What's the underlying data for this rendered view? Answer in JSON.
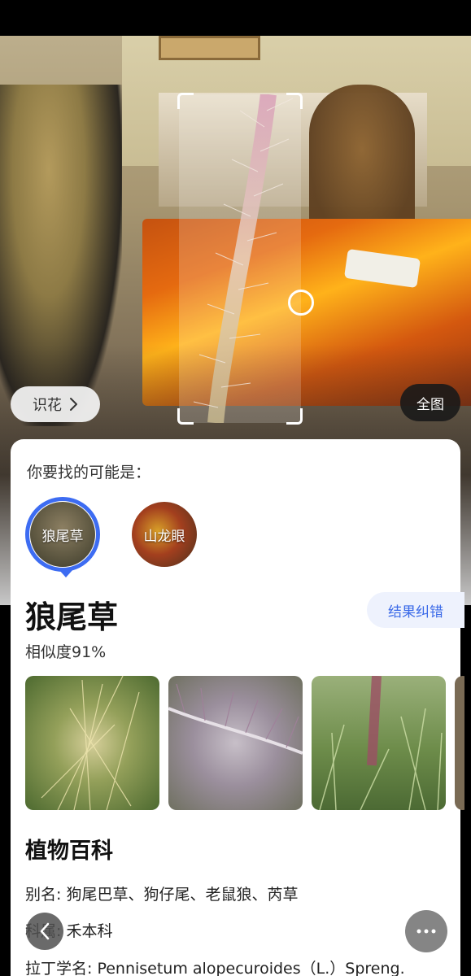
{
  "camera": {
    "recognize_button_label": "识花",
    "full_view_button_label": "全图"
  },
  "result": {
    "prompt": "你要找的可能是：",
    "candidates": [
      {
        "label": "狼尾草",
        "selected": true
      },
      {
        "label": "山龙眼",
        "selected": false
      }
    ],
    "name": "狼尾草",
    "correct_button_label": "结果纠错",
    "similarity": "相似度91%",
    "encyclopedia": {
      "title": "植物百科",
      "alias": "别名: 狗尾巴草、狗仔尾、老鼠狼、芮草",
      "family": "科属: 禾本科",
      "latin_name": "拉丁学名: Pennisetum alopecuroides（L.）Spreng."
    }
  },
  "colors": {
    "accent": "#3d6cf2",
    "correct_button_text": "#3b6ae8",
    "correct_button_bg": "#eef2fd"
  },
  "icons": {
    "back": "chevron-left-icon",
    "more": "more-dots-icon",
    "chevron": "chevron-right-icon"
  }
}
